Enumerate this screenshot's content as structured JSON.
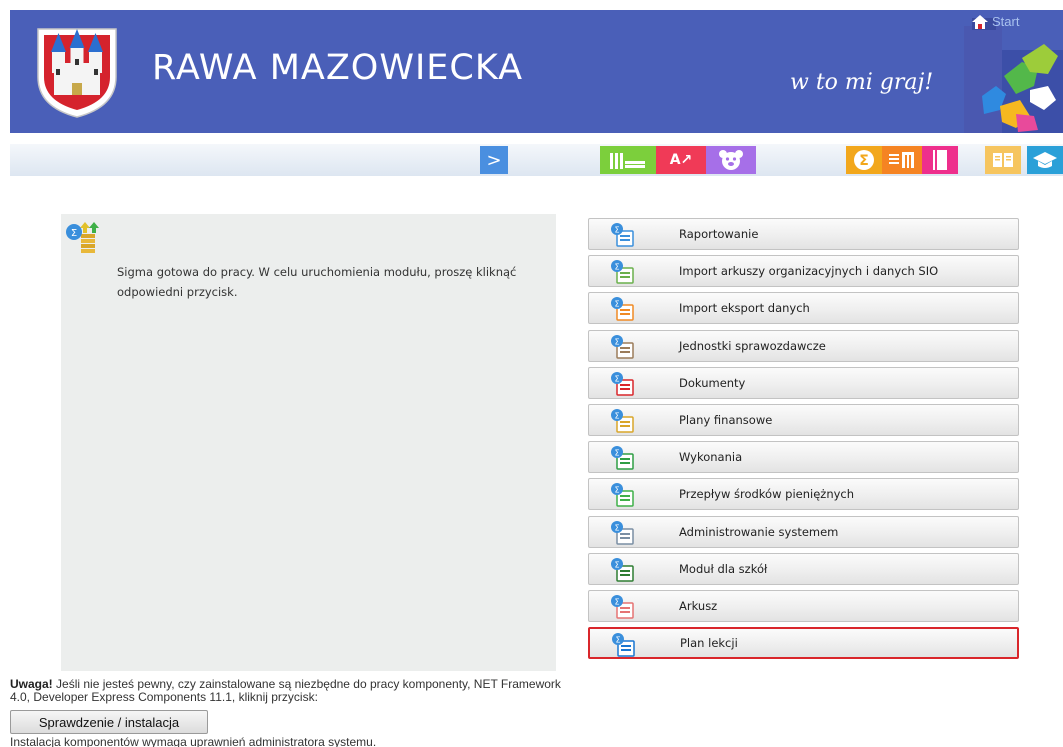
{
  "header": {
    "title": "RAWA MAZOWIECKA",
    "slogan": "w to mi graj!",
    "start_label": "Start",
    "bg_color": "#4a5fb8"
  },
  "toolbar": {
    "icons": [
      "forward-arrow-icon",
      "books-icon",
      "text-cursor-icon",
      "teddy-bear-icon",
      "sigma-icon",
      "library-icon",
      "notebook-icon",
      "open-book-icon",
      "graduation-cap-icon"
    ]
  },
  "info": {
    "message": "Sigma gotowa do pracy. W celu uruchomienia modułu, proszę kliknąć odpowiedni przycisk."
  },
  "modules": [
    {
      "label": "Raportowanie",
      "icon": "report-icon"
    },
    {
      "label": "Import arkuszy organizacyjnych i danych SIO",
      "icon": "sio-import-icon"
    },
    {
      "label": "Import eksport danych",
      "icon": "import-export-icon"
    },
    {
      "label": "Jednostki sprawozdawcze",
      "icon": "reporting-units-icon"
    },
    {
      "label": "Dokumenty",
      "icon": "documents-icon"
    },
    {
      "label": "Plany finansowe",
      "icon": "financial-plans-icon"
    },
    {
      "label": "Wykonania",
      "icon": "executions-icon"
    },
    {
      "label": "Przepływ środków pieniężnych",
      "icon": "cash-flow-icon"
    },
    {
      "label": "Administrowanie systemem",
      "icon": "administration-icon"
    },
    {
      "label": "Moduł dla szkół",
      "icon": "school-module-icon"
    },
    {
      "label": "Arkusz",
      "icon": "sheet-icon"
    },
    {
      "label": "Plan lekcji",
      "icon": "lesson-plan-icon",
      "selected": true
    }
  ],
  "notice": {
    "bold": "Uwaga!",
    "text": " Jeśli nie jesteś pewny, czy zainstalowane są niezbędne do pracy komponenty, NET Framework 4.0, Developer Express Components 11.1, kliknij przycisk:",
    "button_label": "Sprawdzenie / instalacja",
    "install_note": "Instalacja komponentów wymaga uprawnień administratora systemu."
  },
  "colors": {
    "selected_border": "#d9262b",
    "panel_bg": "#eceeed"
  }
}
